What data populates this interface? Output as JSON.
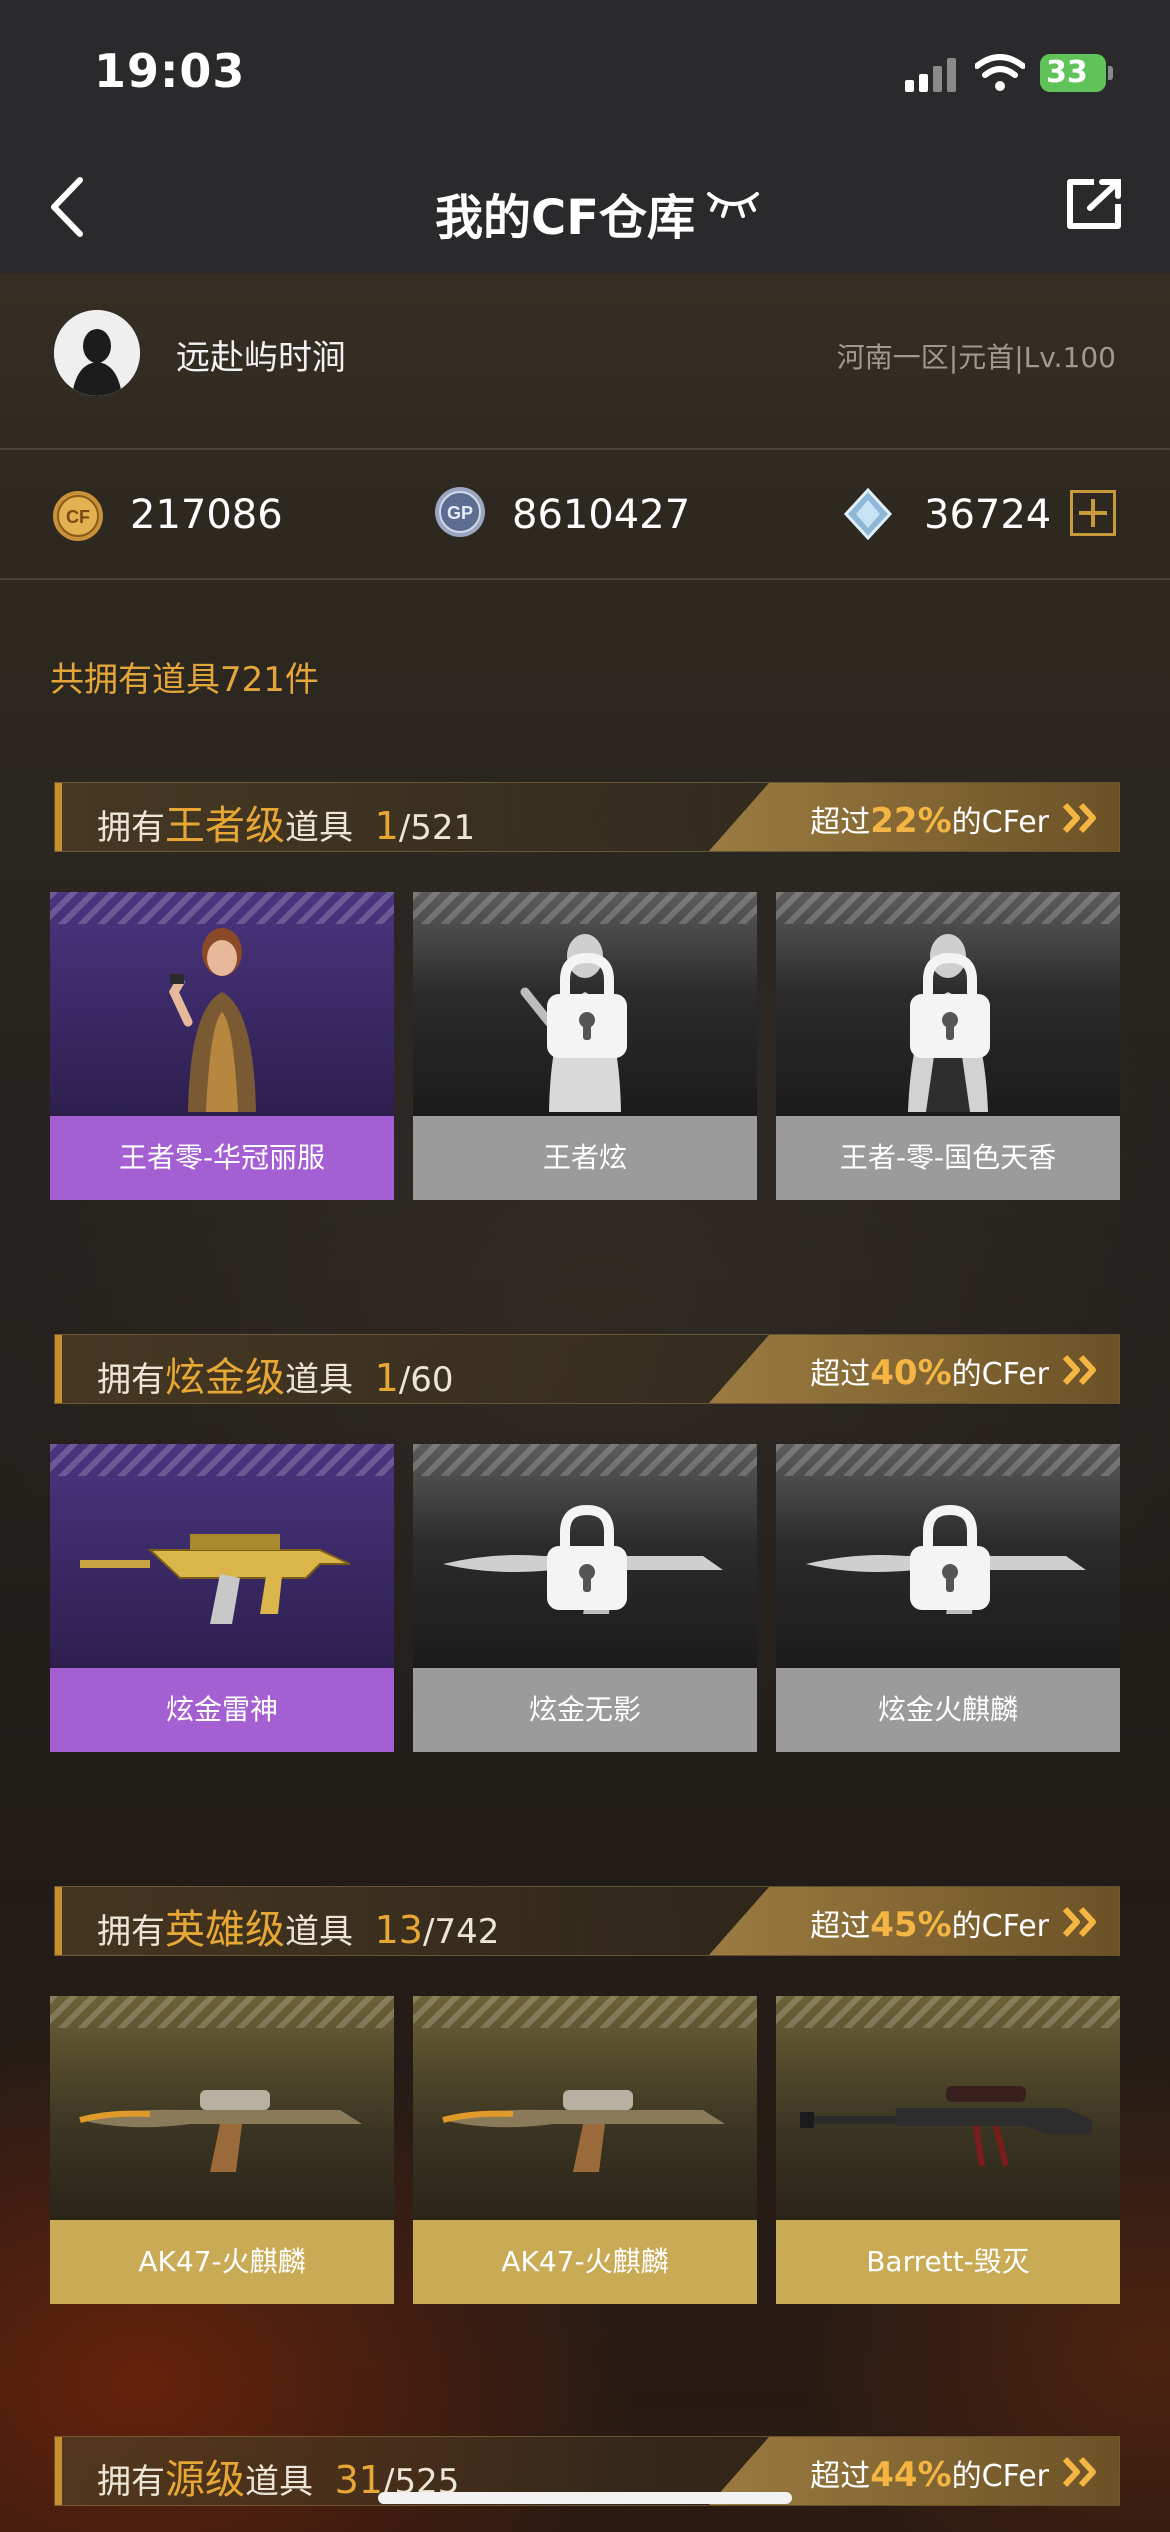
{
  "status_bar": {
    "time": "19:03",
    "battery": "33"
  },
  "nav": {
    "title": "我的CF仓库"
  },
  "profile": {
    "name": "远赴屿时涧",
    "server": "河南一区|元首|Lv.100"
  },
  "currency": [
    {
      "icon": "cf-coin-icon",
      "value": "217086"
    },
    {
      "icon": "gp-coin-icon",
      "value": "8610427"
    },
    {
      "icon": "diamond-icon",
      "value": "36724"
    }
  ],
  "total_items": "共拥有道具721件",
  "sections": [
    {
      "prefix": "拥有",
      "tier": "王者级",
      "suffix": "道具",
      "owned": "1",
      "total": "/521",
      "rank_prefix": "超过",
      "percent": "22%",
      "rank_suffix": "的CFer",
      "items": [
        {
          "name": "王者零-华冠丽服",
          "state": "owned"
        },
        {
          "name": "王者炫",
          "state": "locked"
        },
        {
          "name": "王者-零-国色天香",
          "state": "locked"
        }
      ]
    },
    {
      "prefix": "拥有",
      "tier": "炫金级",
      "suffix": "道具",
      "owned": "1",
      "total": "/60",
      "rank_prefix": "超过",
      "percent": "40%",
      "rank_suffix": "的CFer",
      "items": [
        {
          "name": "炫金雷神",
          "state": "owned"
        },
        {
          "name": "炫金无影",
          "state": "locked"
        },
        {
          "name": "炫金火麒麟",
          "state": "locked"
        }
      ]
    },
    {
      "prefix": "拥有",
      "tier": "英雄级",
      "suffix": "道具",
      "owned": "13",
      "total": "/742",
      "rank_prefix": "超过",
      "percent": "45%",
      "rank_suffix": "的CFer",
      "items": [
        {
          "name": "AK47-火麒麟",
          "state": "owned"
        },
        {
          "name": "AK47-火麒麟",
          "state": "owned"
        },
        {
          "name": "Barrett-毁灭",
          "state": "owned"
        }
      ]
    },
    {
      "prefix": "拥有",
      "tier": "源级",
      "suffix": "道具",
      "owned": "31",
      "total": "/525",
      "rank_prefix": "超过",
      "percent": "44%",
      "rank_suffix": "的CFer",
      "items": []
    }
  ]
}
